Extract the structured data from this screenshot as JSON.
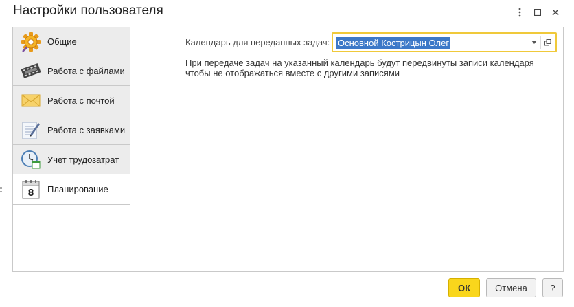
{
  "window": {
    "title": "Настройки пользователя",
    "menu_icon": "more-vert-icon",
    "maximize_icon": "maximize-icon",
    "close_icon": "close-icon"
  },
  "tabs": [
    {
      "label": "Общие",
      "icon": "gear-icon",
      "active": false
    },
    {
      "label": "Работа с файлами",
      "icon": "film-files-icon",
      "active": false
    },
    {
      "label": "Работа с почтой",
      "icon": "envelope-icon",
      "active": false
    },
    {
      "label": "Работа с заявками",
      "icon": "request-pencil-icon",
      "active": false
    },
    {
      "label": "Учет трудозатрат",
      "icon": "clock-calendar-icon",
      "active": false
    },
    {
      "label": "Планирование",
      "icon": "calendar-icon",
      "active": true
    }
  ],
  "calendar_icon_day": "8",
  "planning": {
    "calendar_label": "Календарь для переданных задач:",
    "calendar_value": "Основной Кострицын Олег",
    "note_line1": "При передаче задач на указанный календарь будут передвинуты записи календаря",
    "note_line2": "чтобы не отображаться вместе с другими записями"
  },
  "buttons": {
    "ok": "ОК",
    "cancel": "Отмена",
    "help": "?"
  },
  "colors": {
    "accent_yellow": "#f9d61c",
    "selection_blue": "#3c78c8",
    "focus_border": "#f0c93a"
  }
}
